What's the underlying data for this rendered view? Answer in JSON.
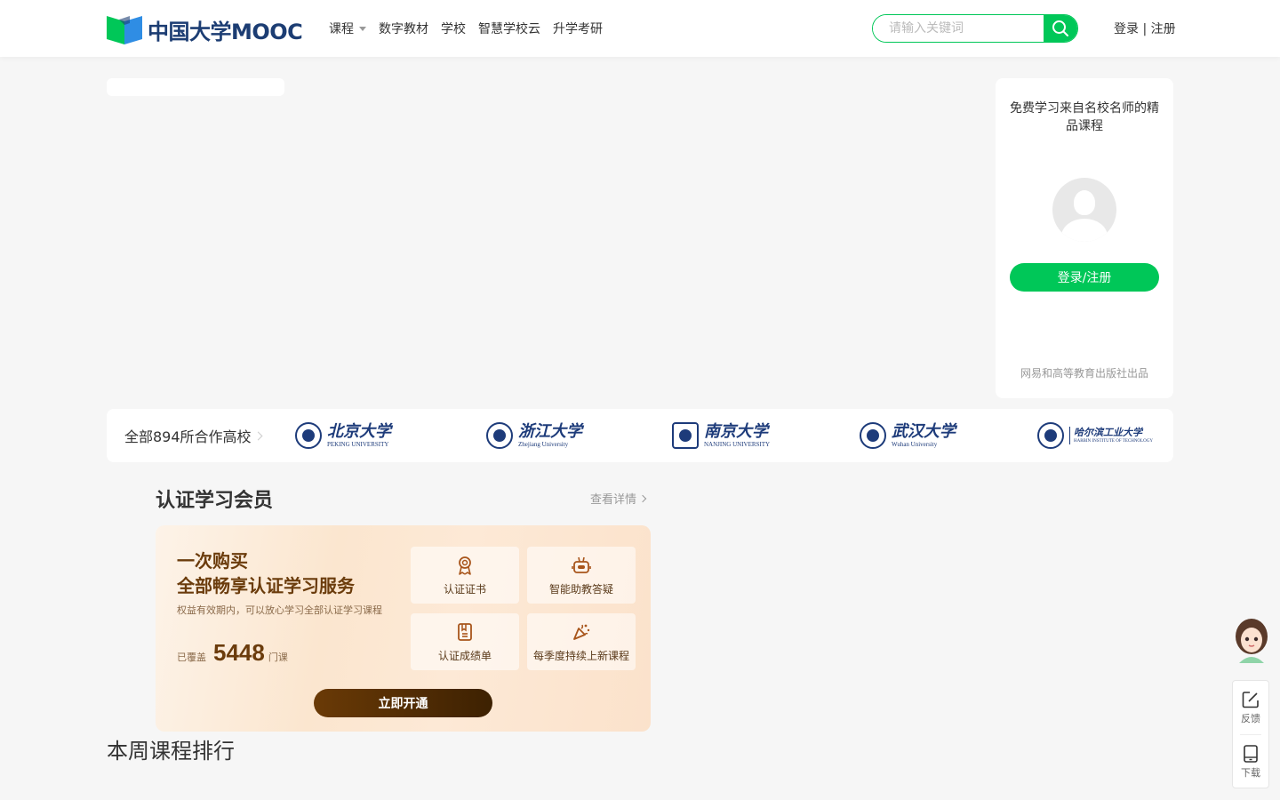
{
  "header": {
    "logo_text": "中国大学MOOC",
    "nav": [
      "课程",
      "数字教材",
      "学校",
      "智慧学校云",
      "升学考研"
    ],
    "search_placeholder": "请输入关键词",
    "login_link": "登录 | 注册"
  },
  "login_card": {
    "slogan": "免费学习来自名校名师的精品课程",
    "button": "登录/注册",
    "footer": "网易和高等教育出版社出品"
  },
  "schools": {
    "all_label": "全部894所合作高校",
    "items": [
      {
        "cn": "北京大学",
        "en": "PEKING UNIVERSITY"
      },
      {
        "cn": "浙江大学",
        "en": "Zhejiang University"
      },
      {
        "cn": "南京大学",
        "en": "NANJING UNIVERSITY"
      },
      {
        "cn": "武汉大学",
        "en": "Wuhan University"
      },
      {
        "cn": "哈尔滨工业大学",
        "en": "HARBIN INSTITUTE OF TECHNOLOGY"
      }
    ]
  },
  "membership": {
    "title": "认证学习会员",
    "more": "查看详情",
    "headline_1": "一次购买",
    "headline_2": "全部畅享认证学习服务",
    "subtitle": "权益有效期内，可以放心学习全部认证学习课程",
    "covered_prefix": "已覆盖",
    "covered_count": "5448",
    "covered_suffix": "门课",
    "features": [
      "认证证书",
      "智能助教答疑",
      "认证成绩单",
      "每季度持续上新课程"
    ],
    "button": "立即开通"
  },
  "ranking": {
    "title": "本周课程排行"
  },
  "floating_tools": {
    "feedback": "反馈",
    "download": "下载"
  },
  "colors": {
    "brand_green": "#00c758",
    "brand_navy": "#1c3d73",
    "member_brown": "#6b3c0c"
  }
}
